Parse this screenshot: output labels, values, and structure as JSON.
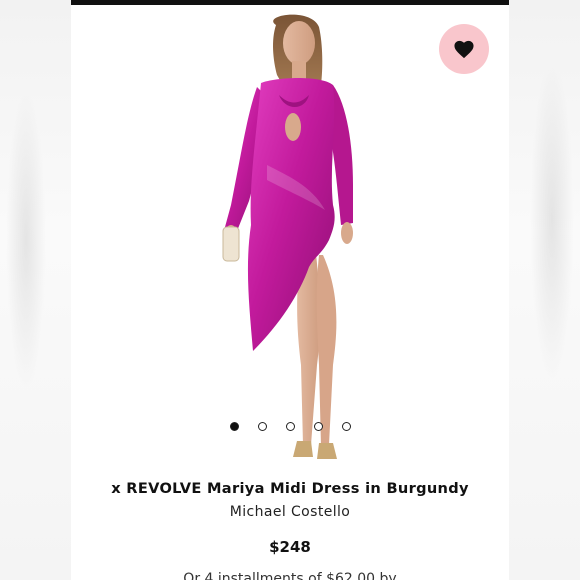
{
  "product": {
    "title": "x REVOLVE Mariya Midi Dress in Burgundy",
    "brand": "Michael Costello",
    "price": "$248",
    "installments_text": "Or 4 installments of $62.00 by",
    "image_alt": "Model wearing magenta satin midi dress"
  },
  "favorite": {
    "icon": "heart-icon",
    "background": "#f9c6cc"
  },
  "carousel": {
    "dot_count": 5,
    "active_index": 0
  },
  "colors": {
    "dress": "#c61aa0",
    "top_bar": "#111111"
  }
}
